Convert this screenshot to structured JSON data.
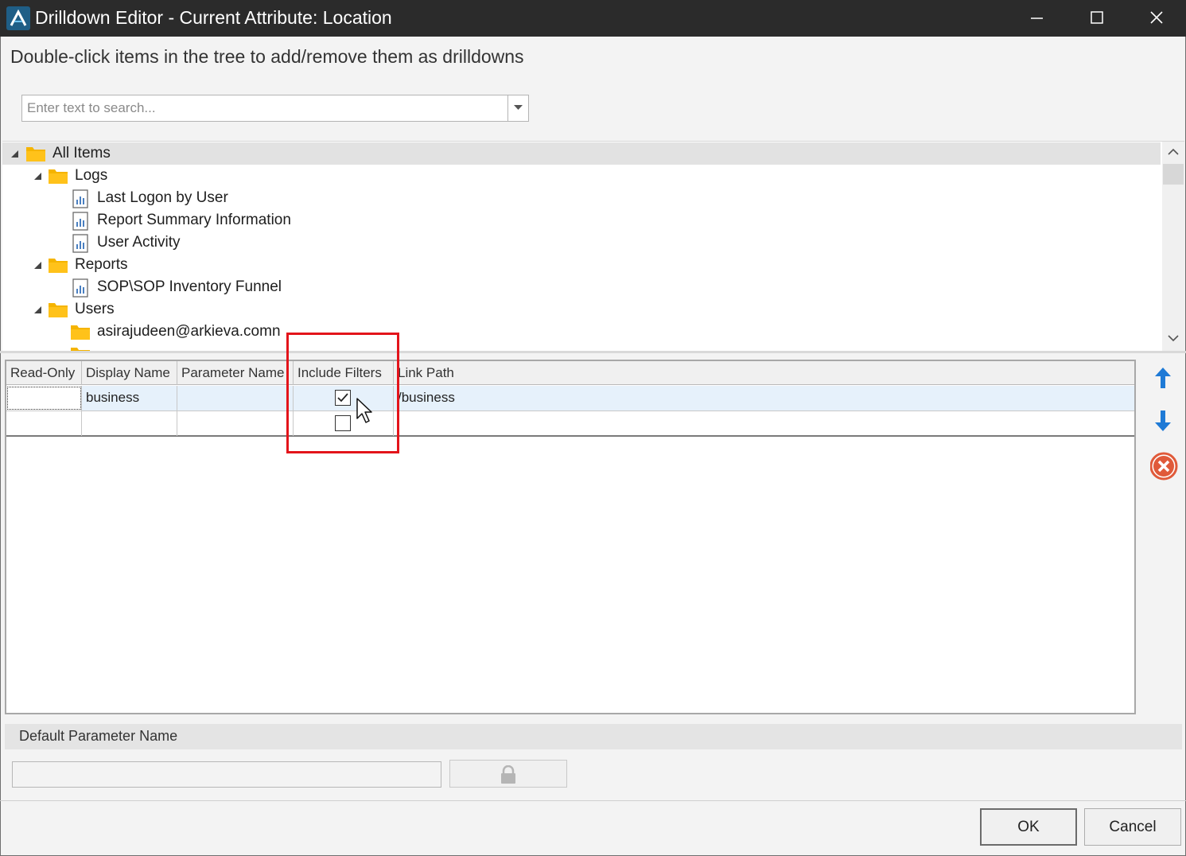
{
  "window": {
    "title": "Drilldown Editor - Current Attribute: Location"
  },
  "instruction": "Double-click items in the tree to add/remove them as drilldowns",
  "search": {
    "placeholder": "Enter text to search...",
    "value": ""
  },
  "tree": {
    "items": [
      {
        "label": "All Items",
        "type": "folder",
        "level": 0,
        "expanded": true,
        "selected": true
      },
      {
        "label": "Logs",
        "type": "folder",
        "level": 1,
        "expanded": true
      },
      {
        "label": "Last Logon by User",
        "type": "report",
        "level": 2
      },
      {
        "label": "Report Summary Information",
        "type": "report",
        "level": 2
      },
      {
        "label": "User Activity",
        "type": "report",
        "level": 2
      },
      {
        "label": "Reports",
        "type": "folder",
        "level": 1,
        "expanded": true
      },
      {
        "label": "SOP\\SOP Inventory Funnel",
        "type": "report",
        "level": 2
      },
      {
        "label": "Users",
        "type": "folder",
        "level": 1,
        "expanded": true
      },
      {
        "label": "asirajudeen@arkieva.comn",
        "type": "folder",
        "level": 2
      }
    ]
  },
  "grid": {
    "columns": [
      "Read-Only",
      "Display Name",
      "Parameter Name",
      "Include Filters",
      "Link Path"
    ],
    "rows": [
      {
        "read_only": "",
        "display_name": "business",
        "parameter_name": "",
        "include_filters": true,
        "link_path": "/business"
      },
      {
        "read_only": "",
        "display_name": "",
        "parameter_name": "",
        "include_filters": false,
        "link_path": ""
      }
    ]
  },
  "side_buttons": [
    "move-up",
    "move-down",
    "delete"
  ],
  "default_parameter": {
    "label": "Default Parameter Name",
    "value": ""
  },
  "buttons": {
    "ok": "OK",
    "cancel": "Cancel"
  },
  "colors": {
    "titlebar": "#2b2b2b",
    "highlight": "#e3141b",
    "arrow_blue": "#1e7ad6",
    "delete_red": "#e05a3a",
    "folder": "#f5b400",
    "selected_row": "#e6f1fb"
  }
}
